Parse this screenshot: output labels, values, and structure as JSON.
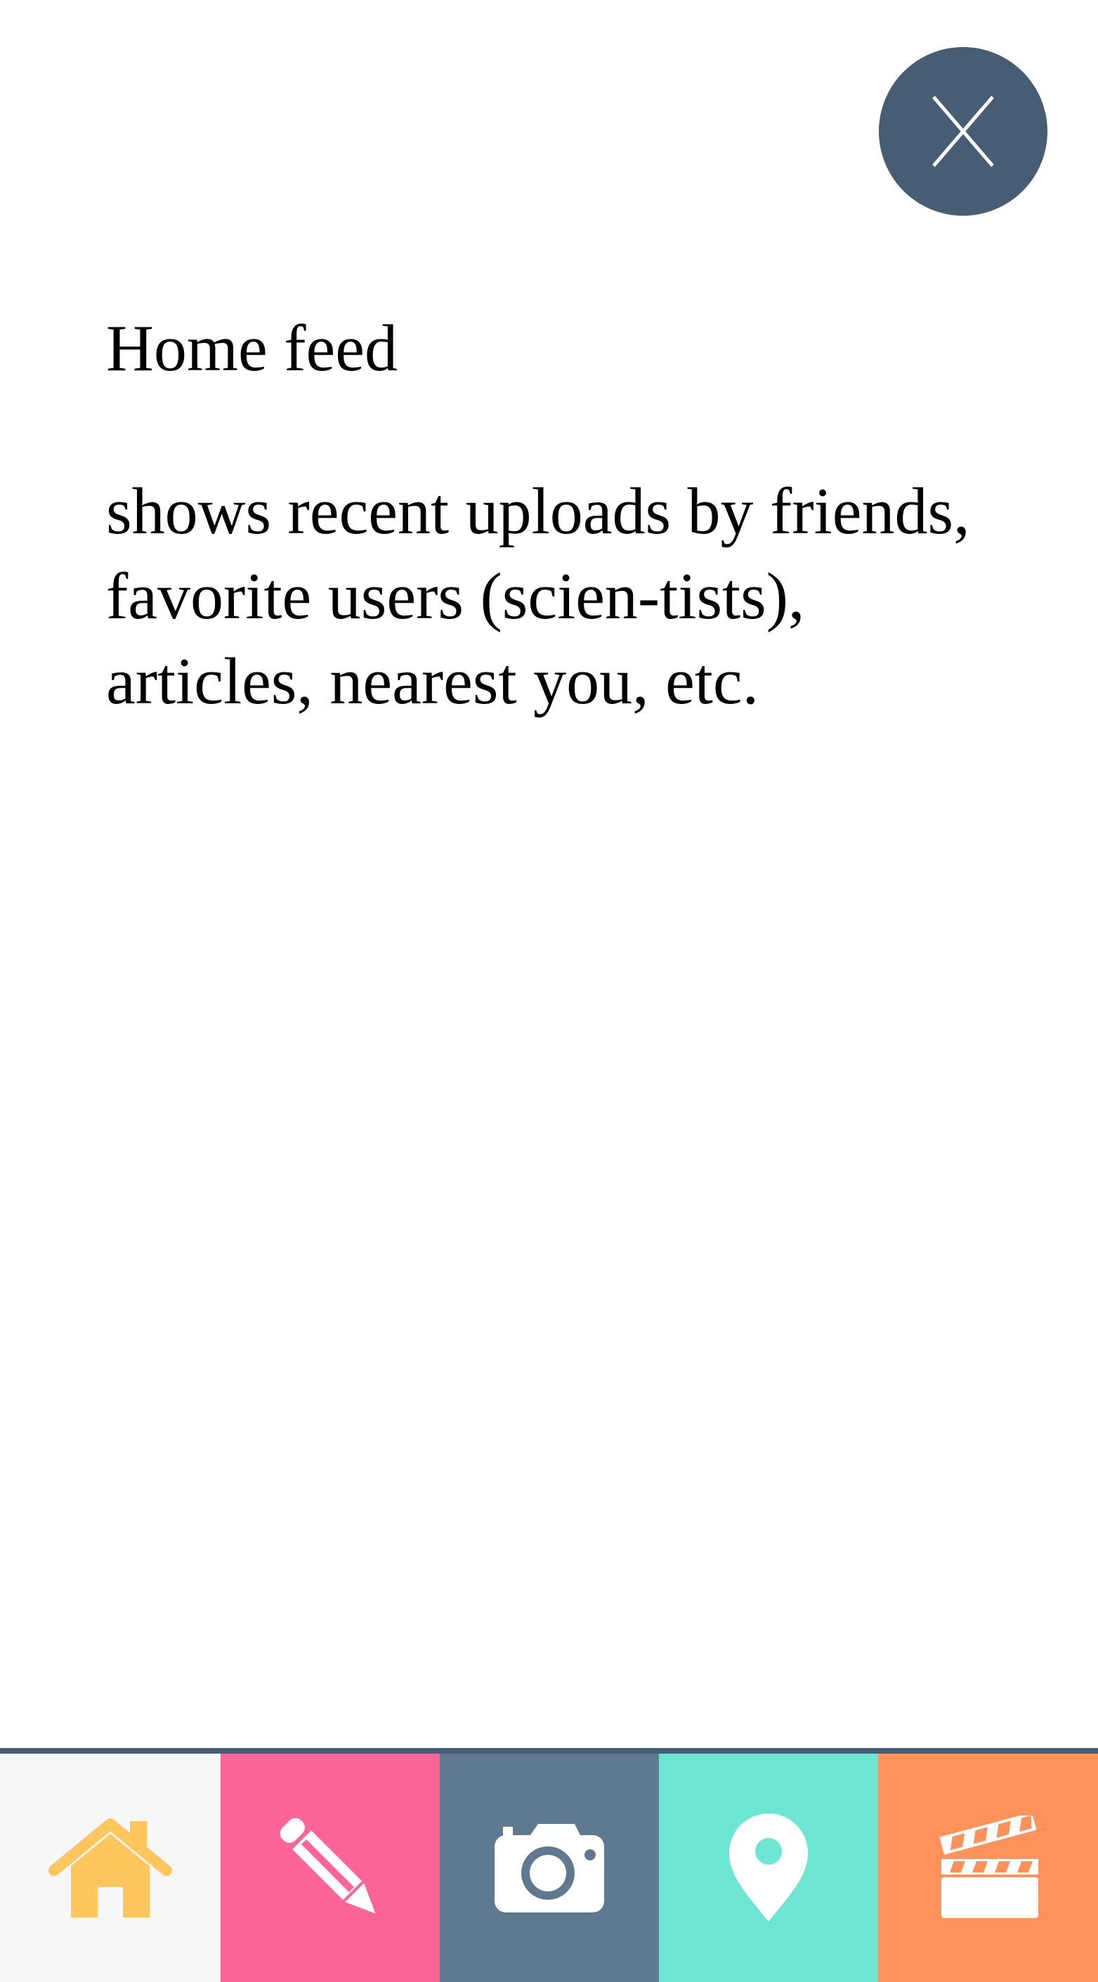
{
  "close_button": {
    "label": "X"
  },
  "content": {
    "title": "Home feed",
    "description": "shows recent uploads by friends, favorite users (scien-tists), articles, nearest you, etc."
  },
  "tabbar": {
    "tabs": [
      {
        "icon": "home-icon",
        "background": "#f7f7f7",
        "icon_color": "#ffc65e",
        "active": true
      },
      {
        "icon": "pencil-icon",
        "background": "#fb6496",
        "icon_color": "#ffffff",
        "active": false
      },
      {
        "icon": "camera-icon",
        "background": "#5e7990",
        "icon_color": "#ffffff",
        "active": false
      },
      {
        "icon": "map-pin-icon",
        "background": "#6ce6d2",
        "icon_color": "#ffffff",
        "active": false
      },
      {
        "icon": "clapperboard-icon",
        "background": "#ff915a",
        "icon_color": "#ffffff",
        "active": false
      }
    ],
    "border_color": "#465d74"
  },
  "colors": {
    "close_button_bg": "#465d74",
    "text": "#000000",
    "background": "#ffffff"
  }
}
